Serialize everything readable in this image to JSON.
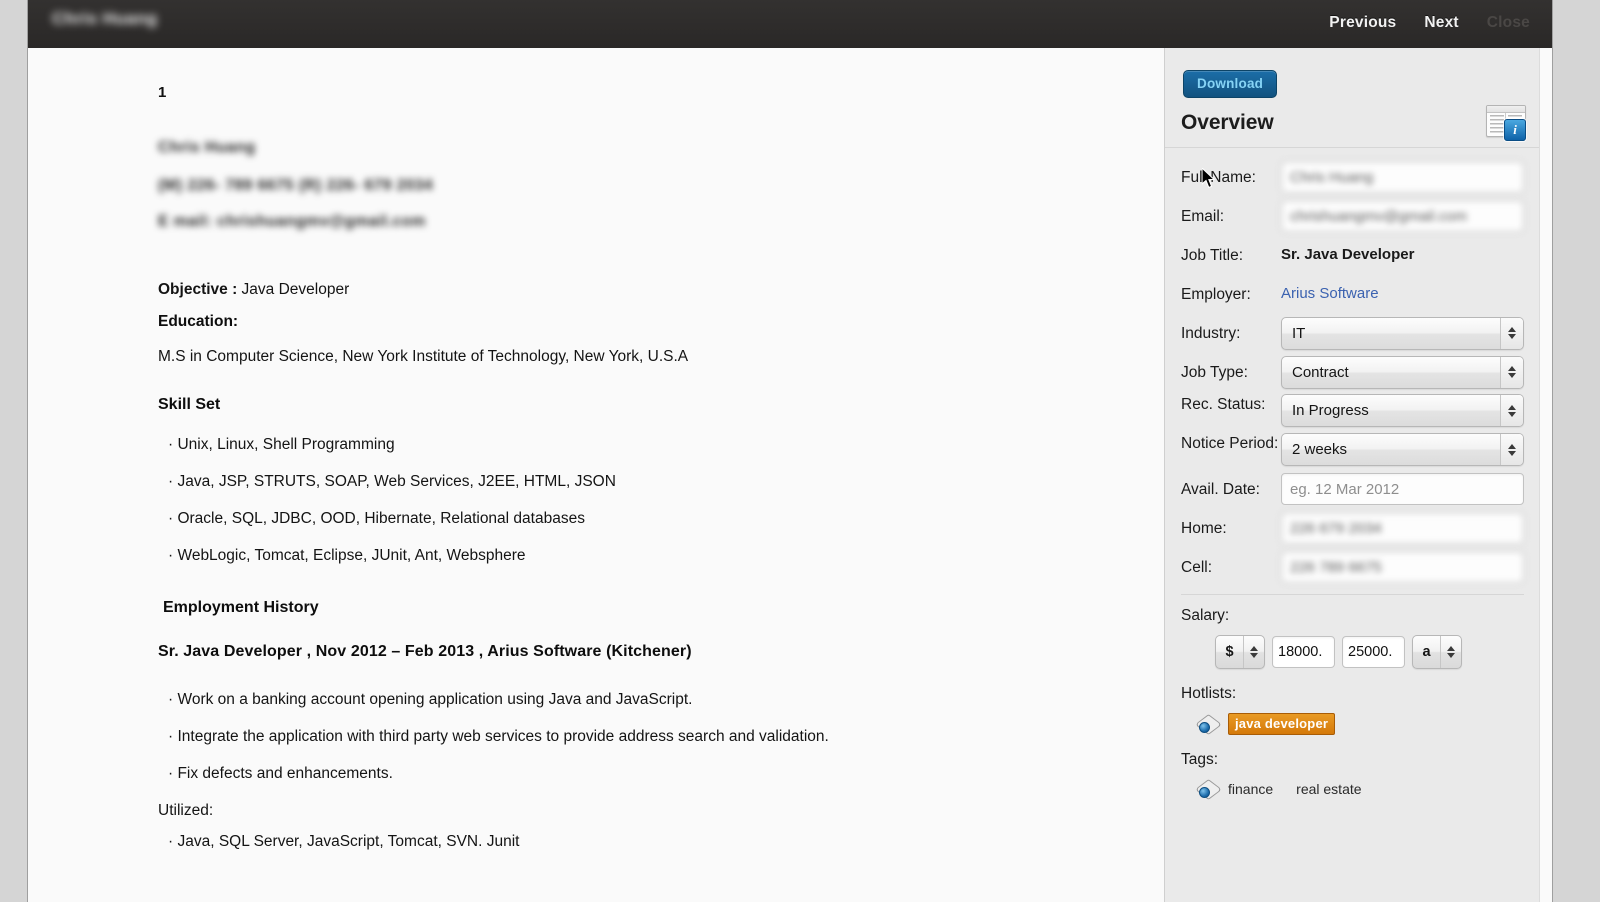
{
  "window": {
    "title_redacted": "Chris Huang",
    "actions": [
      {
        "label": "Previous",
        "state": "enabled"
      },
      {
        "label": "Next",
        "state": "enabled"
      },
      {
        "label": "Close",
        "state": "disabled"
      }
    ]
  },
  "document": {
    "page_number": "1",
    "contact_redacted": [
      "Chris Huang",
      "(M) 226- 789 6675 (R) 226- 679 2034",
      "E mail: chrishuangmv@gmail.com"
    ],
    "objective_label": "Objective :",
    "objective_value": " Java Developer",
    "education_heading": "Education:",
    "education_value": "M.S in Computer Science, New York Institute of Technology, New York, U.S.A",
    "skillset_heading": "Skill Set",
    "skills": [
      "· Unix, Linux, Shell Programming",
      "· Java, JSP, STRUTS, SOAP, Web Services, J2EE, HTML, JSON",
      "· Oracle, SQL, JDBC, OOD, Hibernate, Relational databases",
      "· WebLogic, Tomcat, Eclipse, JUnit, Ant, Websphere"
    ],
    "employment_heading": "Employment History",
    "job_title_line": "Sr. Java Developer , Nov 2012 – Feb 2013 , Arius Software (Kitchener)",
    "job_bullets": [
      "· Work on a banking account opening application using Java and JavaScript.",
      "· Integrate the application with third party web services to provide address search and validation.",
      "· Fix defects and enhancements."
    ],
    "utilized_label": "Utilized:",
    "utilized_value": "· Java, SQL Server, JavaScript, Tomcat, SVN. Junit"
  },
  "sidebar": {
    "download_label": "Download",
    "overview_title": "Overview",
    "doc_info_icon": "document-info-icon",
    "fields": {
      "full_name": {
        "label": "Full Name:",
        "value": "Chris Huang",
        "redacted": true
      },
      "email": {
        "label": "Email:",
        "value": "chrishuangmv@gmail.com",
        "redacted": true
      },
      "job_title": {
        "label": "Job Title:",
        "value": "Sr. Java Developer"
      },
      "employer": {
        "label": "Employer:",
        "value": "Arius Software"
      },
      "industry": {
        "label": "Industry:",
        "value": "IT"
      },
      "job_type": {
        "label": "Job Type:",
        "value": "Contract"
      },
      "rec_status": {
        "label": "Rec. Status:",
        "value": "In Progress"
      },
      "notice_period": {
        "label": "Notice Period:",
        "value": "2 weeks"
      },
      "avail_date": {
        "label": "Avail. Date:",
        "value": "",
        "placeholder": "eg. 12 Mar 2012"
      },
      "home": {
        "label": "Home:",
        "value": "226 679 2034",
        "redacted": true
      },
      "cell": {
        "label": "Cell:",
        "value": "226 789 6675",
        "redacted": true
      }
    },
    "salary": {
      "label": "Salary:",
      "currency": "$",
      "min": "18000.",
      "max": "25000.",
      "period": "a"
    },
    "hotlists": {
      "label": "Hotlists:",
      "items": [
        "java developer"
      ]
    },
    "tags": {
      "label": "Tags:",
      "items": [
        "finance",
        "real estate"
      ]
    }
  },
  "colors": {
    "titlebar": "#2f2d2c",
    "download_bg": "#12527f",
    "download_text": "#86d3f5",
    "link": "#3b62b0",
    "hotlist_chip": "#d4790a",
    "info_badge": "#0e62a8"
  }
}
